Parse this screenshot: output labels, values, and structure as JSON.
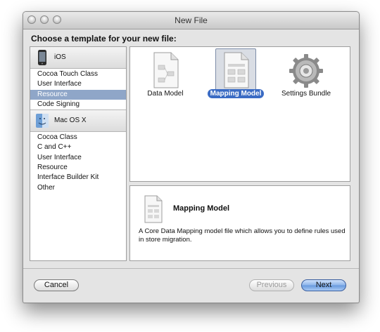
{
  "window": {
    "title": "New File"
  },
  "prompt": "Choose a template for your new file:",
  "sidebar": {
    "groups": [
      {
        "label": "iOS",
        "icon": "iphone-icon",
        "items": [
          "Cocoa Touch Class",
          "User Interface",
          "Resource",
          "Code Signing"
        ],
        "selected_index": 2
      },
      {
        "label": "Mac OS X",
        "icon": "finder-icon",
        "items": [
          "Cocoa Class",
          "C and C++",
          "User Interface",
          "Resource",
          "Interface Builder Kit",
          "Other"
        ]
      }
    ]
  },
  "templates": [
    {
      "label": "Data Model",
      "icon": "document-icon"
    },
    {
      "label": "Mapping Model",
      "icon": "document-icon",
      "selected": true
    },
    {
      "label": "Settings Bundle",
      "icon": "gear-icon"
    }
  ],
  "detail": {
    "title": "Mapping Model",
    "description": "A Core Data Mapping model file which allows you to define rules used in store migration."
  },
  "buttons": {
    "cancel": "Cancel",
    "previous": "Previous",
    "next": "Next"
  },
  "colors": {
    "selection": "#8fa6c8",
    "label_highlight": "#3a6bc4",
    "default_button": "#7fa9e6"
  }
}
